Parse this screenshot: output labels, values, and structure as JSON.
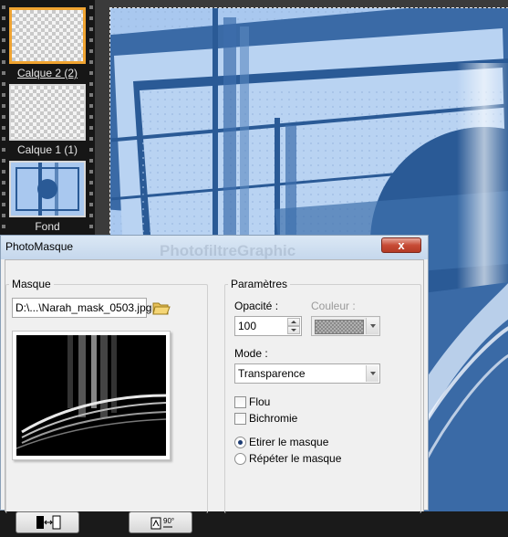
{
  "layers": {
    "items": [
      {
        "label": "Calque 2 (2)",
        "selected": true
      },
      {
        "label": "Calque 1 (1)",
        "selected": false
      },
      {
        "label": "Fond",
        "selected": false
      }
    ]
  },
  "dialog": {
    "title": "PhotoMasque",
    "watermark": "PhotofiltreGraphic",
    "close_label": "x",
    "mask_group": {
      "title": "Masque",
      "file_path": "D:\\...\\Narah_mask_0503.jpg"
    },
    "params_group": {
      "title": "Paramètres",
      "opacity_label": "Opacité :",
      "opacity_value": "100",
      "color_label": "Couleur :",
      "mode_label": "Mode :",
      "mode_value": "Transparence",
      "blur_label": "Flou",
      "blur_checked": false,
      "bichromie_label": "Bichromie",
      "bichromie_checked": false,
      "stretch_label": "Etirer le masque",
      "stretch_selected": true,
      "repeat_label": "Répéter le masque",
      "repeat_selected": false
    },
    "buttons": {
      "invert_icon": "invert-mask-icon",
      "rotate_icon": "rotate-90-icon",
      "rotate_text": "90°"
    }
  },
  "colors": {
    "accent_selected": "#f0a431",
    "canvas_blue": "#2a5a96",
    "canvas_light": "#a9c8ef"
  }
}
